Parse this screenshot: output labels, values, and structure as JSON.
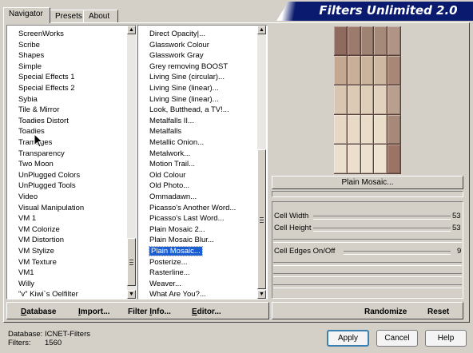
{
  "tabs": [
    {
      "label": "Navigator",
      "active": true
    },
    {
      "label": "Presets",
      "active": false
    },
    {
      "label": "About",
      "active": false
    }
  ],
  "app_title": "Filters Unlimited 2.0",
  "categories": [
    "ScreenWorks",
    "Scribe",
    "Shapes",
    "Simple",
    "Special Effects 1",
    "Special Effects 2",
    "Sybia",
    "Tile & Mirror",
    "Toadies Distort",
    "Toadies",
    "Tramages",
    "Transparency",
    "Two Moon",
    "UnPlugged Colors",
    "UnPlugged Tools",
    "Video",
    "Visual Manipulation",
    "VM 1",
    "VM Colorize",
    "VM Distortion",
    "VM Stylize",
    "VM Texture",
    "VM1",
    "Willy",
    "\"v\" Kiwi`s Oelfilter"
  ],
  "filters": [
    "Direct Opacity|...",
    "Glasswork Colour",
    "Glasswork Gray",
    "Grey removing BOOST",
    "Living Sine (circular)...",
    "Living Sine (linear)...",
    "Living Sine (linear)...",
    "Look, Butthead, a TV!...",
    "Metalfalls II...",
    "Metalfalls",
    "Metallic Onion...",
    "Metalwork...",
    "Motion Trail...",
    "Old Colour",
    "Old Photo...",
    "Ommadawn...",
    "Picasso's Another Word...",
    "Picasso's Last Word...",
    "Plain Mosaic 2...",
    "Plain Mosaic Blur...",
    "Plain Mosaic...",
    "Posterize...",
    "Rasterline...",
    "Weaver...",
    "What Are You?..."
  ],
  "selected_filter": "Plain Mosaic...",
  "preview_filter_name": "Plain Mosaic...",
  "parameters": [
    {
      "label": "Cell Width",
      "value": "53"
    },
    {
      "label": "Cell Height",
      "value": "53"
    },
    {
      "label": "Cell Edges On/Off",
      "value": "9"
    }
  ],
  "randomize_label": "Randomize",
  "reset_label": "Reset",
  "bottom_links": {
    "database": {
      "u": "D",
      "rest": "atabase"
    },
    "import": {
      "u": "I",
      "rest": "mport..."
    },
    "filter_info": {
      "pre": "Filter ",
      "u": "I",
      "rest": "nfo..."
    },
    "editor": {
      "u": "E",
      "rest": "ditor..."
    }
  },
  "status": {
    "database_label": "Database:",
    "database_value": "ICNET-Filters",
    "filters_label": "Filters:",
    "filters_value": "1560"
  },
  "buttons": {
    "apply": "Apply",
    "cancel": "Cancel",
    "help": "Help"
  },
  "colors": {
    "selection": "#1a5fd1",
    "banner": "#0a1a6e",
    "mosaic": [
      [
        "#8f6a5e",
        "#9c7a6c",
        "#a08272",
        "#a58a7a",
        "#b09486"
      ],
      [
        "#c4a892",
        "#c9ae98",
        "#ccb39c",
        "#cfb8a2",
        "#a88776"
      ],
      [
        "#d8c6b0",
        "#dccab4",
        "#dfceb8",
        "#e2d1bc",
        "#b9a08e"
      ],
      [
        "#e6d8c4",
        "#e8dac6",
        "#eadcc8",
        "#ebdec9",
        "#a7897a"
      ],
      [
        "#ebdfcd",
        "#ecdfcc",
        "#ede0ce",
        "#eee2d0",
        "#9c7466"
      ]
    ]
  }
}
